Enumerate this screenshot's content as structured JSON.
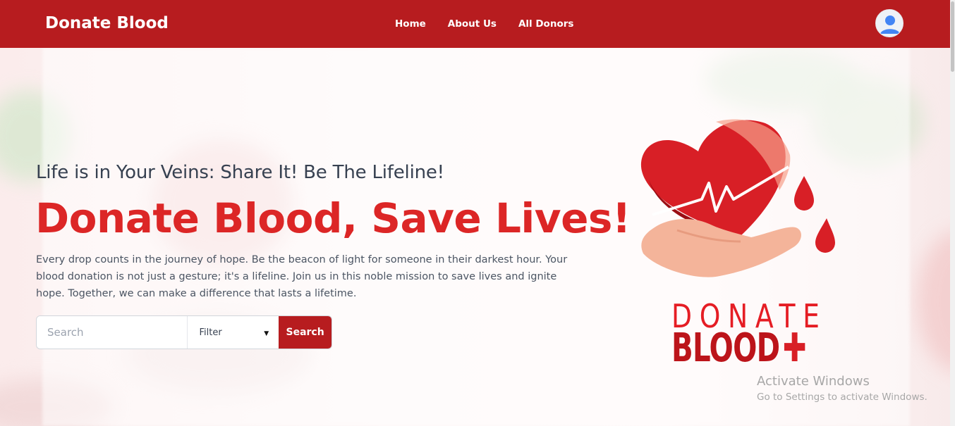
{
  "nav": {
    "brand": "Donate Blood",
    "links": [
      "Home",
      "About Us",
      "All Donors"
    ]
  },
  "hero": {
    "tagline": "Life is in Your Veins: Share It! Be The Lifeline!",
    "headline": "Donate Blood, Save Lives!",
    "description": "Every drop counts in the journey of hope. Be the beacon of light for someone in their darkest hour. Your blood donation is not just a gesture; it's a lifeline. Join us in this noble mission to save lives and ignite hope. Together, we can make a difference that lasts a lifetime."
  },
  "search": {
    "placeholder": "Search",
    "value": "",
    "filter_label": "Filter",
    "button_label": "Search"
  },
  "logo": {
    "line1": "DONATE",
    "line2": "BLOOD"
  },
  "watermark": {
    "title": "Activate Windows",
    "subtitle": "Go to Settings to activate Windows."
  },
  "colors": {
    "navbar": "#b71c1f",
    "headline": "#dc2626",
    "button": "#b71c1f"
  },
  "icons": {
    "avatar": "user-avatar-icon",
    "filter_caret": "caret-down-icon",
    "logo": "heart-hand-logo"
  }
}
